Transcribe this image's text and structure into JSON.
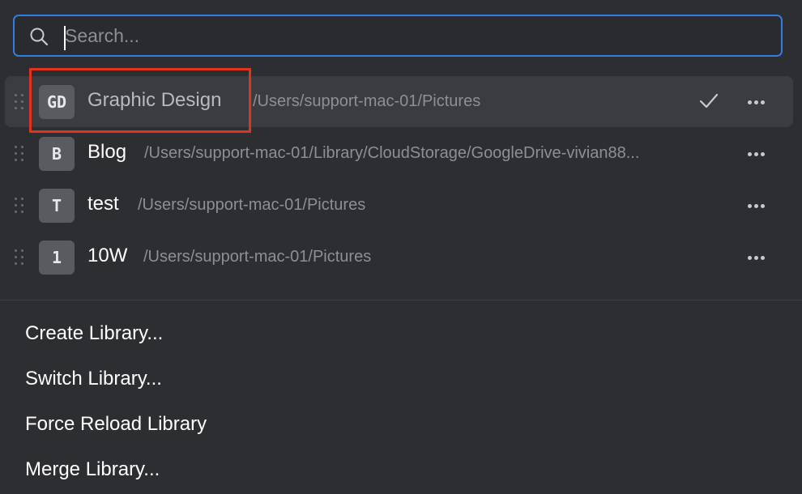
{
  "search": {
    "placeholder": "Search...",
    "value": ""
  },
  "libraries": [
    {
      "badge": "GD",
      "name": "Graphic Design",
      "path": "/Users/support-mac-01/Pictures",
      "selected": true
    },
    {
      "badge": "B",
      "name": "Blog",
      "path": "/Users/support-mac-01/Library/CloudStorage/GoogleDrive-vivian88...",
      "selected": false
    },
    {
      "badge": "T",
      "name": "test",
      "path": "/Users/support-mac-01/Pictures",
      "selected": false
    },
    {
      "badge": "1",
      "name": "10W",
      "path": "/Users/support-mac-01/Pictures",
      "selected": false
    }
  ],
  "menu": {
    "create": "Create Library...",
    "switch": "Switch Library...",
    "reload": "Force Reload Library",
    "merge": "Merge Library..."
  },
  "colors": {
    "accent": "#2f7de1",
    "highlight": "#e0321c",
    "background": "#2d2e32"
  },
  "icons": {
    "search": "search-icon",
    "check": "checkmark-icon",
    "more": "more-icon",
    "drag": "drag-handle-icon"
  }
}
